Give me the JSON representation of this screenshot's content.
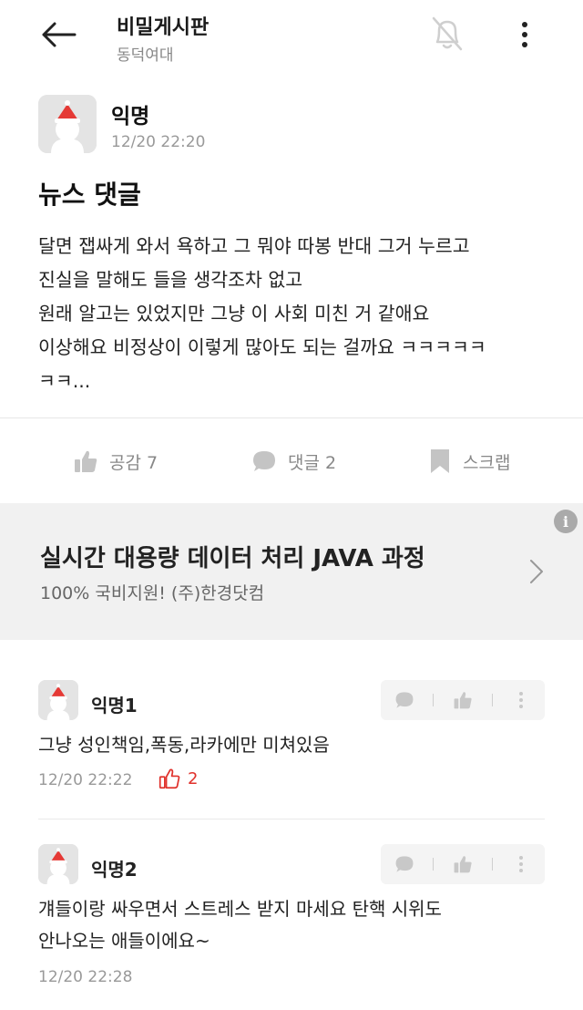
{
  "header": {
    "title": "비밀게시판",
    "subtitle": "동덕여대"
  },
  "post": {
    "author": "익명",
    "time": "12/20 22:20",
    "title": "뉴스 댓글",
    "body_lines": [
      "달면 잽싸게 와서 욕하고 그 뭐야 따봉 반대 그거 누르고",
      "진실을 말해도 들을 생각조차 없고",
      "원래 알고는 있었지만 그냥 이 사회 미친 거 같애요",
      "이상해요 비정상이 이렇게 많아도 되는 걸까요 ㅋㅋㅋㅋㅋ",
      "ㅋㅋ..."
    ],
    "actions": {
      "like": "공감 7",
      "comment": "댓글 2",
      "scrap": "스크랩"
    }
  },
  "ad": {
    "title": "실시간 대용량 데이터 처리 JAVA 과정",
    "subtitle": "100% 국비지원! (주)한경닷컴",
    "info_glyph": "i"
  },
  "comments": [
    {
      "author": "익명1",
      "text_lines": [
        "그냥 성인책임,폭동,라카에만 미쳐있음"
      ],
      "time": "12/20 22:22",
      "likes": "2"
    },
    {
      "author": "익명2",
      "text_lines": [
        "걔들이랑 싸우면서 스트레스 받지 마세요 탄핵 시위도",
        "안나오는 애들이에요~"
      ],
      "time": "12/20 22:28"
    }
  ],
  "colors": {
    "accent_red": "#e0312b",
    "muted_gray": "#888888",
    "ad_background": "#f1f1f1"
  },
  "icons": {
    "back": "arrow-left-icon",
    "bell": "bell-off-icon",
    "more": "more-vertical-icon",
    "like": "thumbs-up-icon",
    "comment": "speech-bubble-icon",
    "scrap": "bookmark-icon",
    "chevron": "chevron-right-icon",
    "info": "info-icon"
  }
}
